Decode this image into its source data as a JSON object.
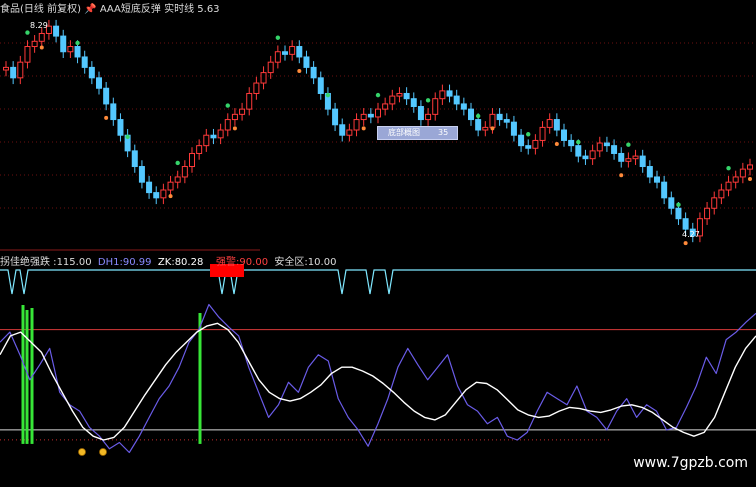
{
  "header": {
    "title": "食品(日线 前复权)",
    "indicator_name": "AAA短底反弹",
    "realtime_label": "实时线",
    "realtime_value": "5.63"
  },
  "price_labels": {
    "high": "8.29",
    "low": "4.27"
  },
  "tooltip": {
    "label": "底部概图",
    "value": "35"
  },
  "indicator_header": {
    "label1": "拐佳绝强跌",
    "value1": "115.00",
    "label2": "DH1",
    "value2": "90.99",
    "label3": "ZK",
    "value3": "80.28",
    "label4": "强警",
    "value4": "90.00",
    "label5": "安全区",
    "value5": "10.00"
  },
  "watermark": "www.7gpzb.com",
  "colors": {
    "background": "#000000",
    "candle_up": "#ff3a3a",
    "candle_down": "#54c8ff",
    "signal_cyan": "#7fe8ff",
    "indicator_line": "#6a5ce8",
    "smooth_line": "#ffffff",
    "buy_bar": "#37e637",
    "alert_block": "#ff0000",
    "level_line": "#d83a3a",
    "grid_dot": "#c22a2a"
  },
  "chart_data": [
    {
      "type": "candlestick",
      "title": "食品(日线 前复权)",
      "ylim": [
        4.0,
        8.6
      ],
      "annotated_high": 8.29,
      "annotated_low": 4.27,
      "close": [
        7.5,
        7.3,
        7.6,
        7.9,
        8.0,
        8.15,
        8.29,
        8.1,
        7.8,
        7.9,
        7.7,
        7.5,
        7.3,
        7.1,
        6.8,
        6.5,
        6.2,
        5.9,
        5.6,
        5.3,
        5.1,
        5.0,
        5.15,
        5.3,
        5.4,
        5.6,
        5.85,
        6.0,
        6.2,
        6.15,
        6.3,
        6.5,
        6.6,
        6.7,
        7.0,
        7.2,
        7.4,
        7.6,
        7.8,
        7.75,
        7.9,
        7.7,
        7.5,
        7.3,
        7.0,
        6.7,
        6.4,
        6.2,
        6.3,
        6.5,
        6.6,
        6.55,
        6.7,
        6.8,
        6.95,
        7.0,
        6.9,
        6.75,
        6.5,
        6.6,
        6.9,
        7.05,
        6.95,
        6.8,
        6.7,
        6.5,
        6.3,
        6.35,
        6.6,
        6.5,
        6.45,
        6.2,
        6.0,
        5.95,
        6.1,
        6.35,
        6.5,
        6.3,
        6.1,
        6.0,
        5.8,
        5.75,
        5.9,
        6.05,
        6.0,
        5.85,
        5.7,
        5.75,
        5.8,
        5.6,
        5.4,
        5.3,
        5.0,
        4.8,
        4.6,
        4.4,
        4.27,
        4.6,
        4.8,
        5.0,
        5.15,
        5.3,
        5.4,
        5.55,
        5.63
      ]
    },
    {
      "type": "line",
      "title": "AAA短底反弹",
      "ylim": [
        -10,
        120
      ],
      "reference_levels": [
        90,
        10
      ],
      "series": [
        {
          "name": "DH1",
          "values": [
            80,
            88,
            70,
            50,
            62,
            75,
            40,
            30,
            25,
            12,
            5,
            -5,
            0,
            -8,
            5,
            20,
            35,
            45,
            60,
            80,
            90,
            110,
            100,
            92,
            85,
            60,
            40,
            20,
            30,
            48,
            40,
            60,
            70,
            65,
            35,
            20,
            10,
            -3,
            15,
            35,
            60,
            75,
            62,
            50,
            60,
            70,
            45,
            30,
            25,
            15,
            20,
            5,
            2,
            8,
            25,
            40,
            35,
            30,
            45,
            25,
            20,
            10,
            25,
            35,
            20,
            30,
            25,
            10,
            12,
            28,
            45,
            68,
            55,
            82,
            88,
            96,
            103
          ]
        },
        {
          "name": "ZK",
          "values": [
            70,
            85,
            88,
            80,
            72,
            55,
            40,
            25,
            12,
            5,
            2,
            4,
            12,
            25,
            38,
            50,
            62,
            72,
            80,
            88,
            93,
            95,
            90,
            80,
            65,
            50,
            40,
            35,
            33,
            35,
            40,
            46,
            55,
            60,
            60,
            57,
            53,
            47,
            40,
            32,
            25,
            20,
            18,
            22,
            32,
            42,
            48,
            47,
            42,
            34,
            26,
            22,
            20,
            21,
            25,
            28,
            27,
            25,
            24,
            26,
            29,
            30,
            28,
            24,
            18,
            12,
            8,
            5,
            8,
            20,
            40,
            60,
            75,
            85
          ]
        }
      ]
    }
  ]
}
